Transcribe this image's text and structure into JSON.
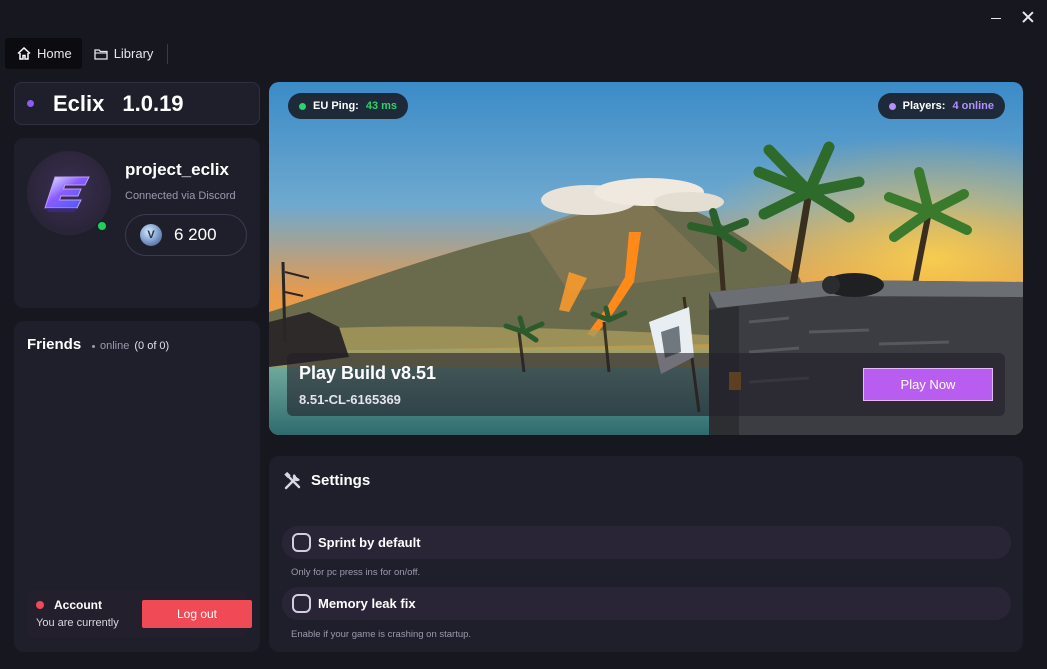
{
  "window": {
    "minimize_icon": "minimize-icon",
    "close_icon": "close-icon"
  },
  "tabs": [
    {
      "label": "Home",
      "icon": "home-icon",
      "active": true
    },
    {
      "label": "Library",
      "icon": "folder-icon",
      "active": false
    }
  ],
  "brand": {
    "name": "Eclix",
    "version": "1.0.19",
    "dot_color": "#8d5cf6"
  },
  "profile": {
    "username": "project_eclix",
    "connection": "Connected via Discord",
    "currency_amount": "6 200",
    "status_color": "#1fd05a"
  },
  "friends": {
    "title": "Friends",
    "online_label": "online",
    "count": "(0 of 0)"
  },
  "account": {
    "label": "Account",
    "subtitle": "You are currently",
    "logout_label": "Log out",
    "accent": "#ef4a56"
  },
  "hero": {
    "ping_label": "EU Ping:",
    "ping_value": "43 ms",
    "players_label": "Players:",
    "players_value": "4 online",
    "build_title": "Play Build v8.51",
    "build_id": "8.51-CL-6165369",
    "play_label": "Play Now",
    "play_color": "#b85df0"
  },
  "settings": {
    "title": "Settings",
    "options": [
      {
        "label": "Sprint by default",
        "hint": "Only for pc press ins for on/off.",
        "checked": false
      },
      {
        "label": "Memory leak fix",
        "hint": "Enable if your game is crashing on startup.",
        "checked": false
      }
    ]
  }
}
